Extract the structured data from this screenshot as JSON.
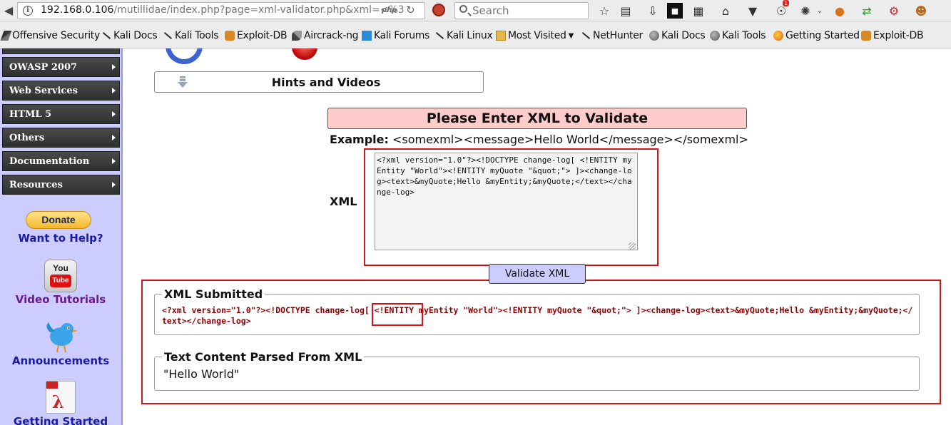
{
  "browser": {
    "url_host": "192.168.0.106",
    "url_path": "/mutillidae/index.php?page=xml-validator.php&xml=<%3",
    "php_badge": "php",
    "search_placeholder": "Search",
    "notification_badge": "1"
  },
  "bookmarks": [
    {
      "label": "Offensive Security",
      "icon": "kali-dragon-icon"
    },
    {
      "label": "Kali Docs",
      "icon": "kali-sword-icon"
    },
    {
      "label": "Kali Tools",
      "icon": "kali-sword-icon"
    },
    {
      "label": "Exploit-DB",
      "icon": "exploit-db-icon"
    },
    {
      "label": "Aircrack-ng",
      "icon": "aircrack-icon"
    },
    {
      "label": "Kali Forums",
      "icon": "forum-icon"
    },
    {
      "label": "Kali Linux",
      "icon": "kali-sword-icon"
    },
    {
      "label": "Most Visited",
      "icon": "folder-icon"
    },
    {
      "label": "NetHunter",
      "icon": "kali-sword-icon"
    },
    {
      "label": "Kali Docs",
      "icon": "globe-icon"
    },
    {
      "label": "Kali Tools",
      "icon": "globe-icon"
    },
    {
      "label": "Getting Started",
      "icon": "firefox-icon"
    },
    {
      "label": "Exploit-DB",
      "icon": "exploit-db-icon"
    }
  ],
  "sidebar": {
    "menu": [
      {
        "label": "OWASP 2007"
      },
      {
        "label": "Web Services"
      },
      {
        "label": "HTML 5"
      },
      {
        "label": "Others"
      },
      {
        "label": "Documentation"
      },
      {
        "label": "Resources"
      }
    ],
    "donate_label": "Donate",
    "help_link": "Want to Help?",
    "youtube_you": "You",
    "youtube_tube": "Tube",
    "video_link": "Video Tutorials",
    "announce_link": "Announcements",
    "getting_started_link": "Getting Started"
  },
  "main": {
    "hints_label": "Hints and Videos",
    "form_title": "Please Enter XML to Validate",
    "example_label": "Example:",
    "example_value": "<somexml><message>Hello World</message></somexml>",
    "xml_label": "XML",
    "xml_value": "<?xml version=\"1.0\"?><!DOCTYPE change-log[ <!ENTITY myEntity \"World\"><!ENTITY myQuote \"&quot;\"> ]><change-log><text>&myQuote;Hello &myEntity;&myQuote;</text></change-log>",
    "validate_button": "Validate XML",
    "submitted_legend": "XML Submitted",
    "submitted_value": "<?xml version=\"1.0\"?><!DOCTYPE change-log[ <!ENTITY myEntity \"World\"><!ENTITY myQuote \"&quot;\"> ]><change-log><text>&myQuote;Hello &myEntity;&myQuote;</text></change-log>",
    "parsed_legend": "Text Content Parsed From XML",
    "parsed_value": "\"Hello World\""
  },
  "colors": {
    "sidebar_bg": "#ccccff",
    "form_title_bg": "#ffcccc",
    "submitted_text": "#8b0000",
    "annotation_red": "#d0141c"
  }
}
